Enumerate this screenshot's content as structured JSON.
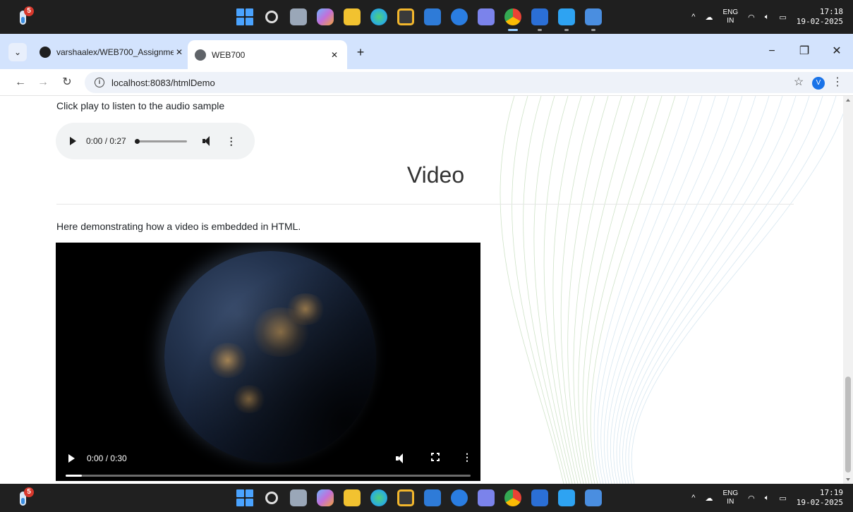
{
  "taskbar_top": {
    "weather_badge": "5",
    "lang_top": "ENG",
    "lang_bottom": "IN",
    "time": "17:18",
    "date": "19-02-2025"
  },
  "taskbar_bottom": {
    "weather_badge": "5",
    "lang_top": "ENG",
    "lang_bottom": "IN",
    "time": "17:19",
    "date": "19-02-2025"
  },
  "taskbar_apps": [
    {
      "name": "start",
      "color": "#4aa3ff"
    },
    {
      "name": "search",
      "color": "#cfcfcf"
    },
    {
      "name": "task-view",
      "color": "#9aa7b8"
    },
    {
      "name": "copilot",
      "color": "#6fb4ff"
    },
    {
      "name": "file-explorer",
      "color": "#f2c230"
    },
    {
      "name": "edge",
      "color": "#2cb0d8"
    },
    {
      "name": "store",
      "color": "#f3b72c"
    },
    {
      "name": "myhp",
      "color": "#2e7bd8"
    },
    {
      "name": "support",
      "color": "#2a7de1"
    },
    {
      "name": "teams",
      "color": "#7b83eb"
    },
    {
      "name": "chrome",
      "color": "#34a853"
    },
    {
      "name": "word",
      "color": "#2b6fd6"
    },
    {
      "name": "vscode",
      "color": "#2ea3f2"
    },
    {
      "name": "photos",
      "color": "#4a8ee0"
    }
  ],
  "browser": {
    "tabs": [
      {
        "title": "varshaalex/WEB700_Assignmen",
        "favicon_color": "#1f1f1f"
      },
      {
        "title": "WEB700",
        "favicon_color": "#5f6368"
      }
    ],
    "url": "localhost:8083/htmlDemo",
    "profile_initial": "V"
  },
  "page": {
    "audio_caption": "Click play to listen to the audio sample",
    "audio_time": "0:00 / 0:27",
    "section_title": "Video",
    "video_caption": "Here demonstrating how a video is embedded in HTML.",
    "video_time": "0:00 / 0:30",
    "video_progress": 0.04
  },
  "colors": {
    "tabstrip": "#d3e3fd",
    "accent": "#1a73e8"
  }
}
